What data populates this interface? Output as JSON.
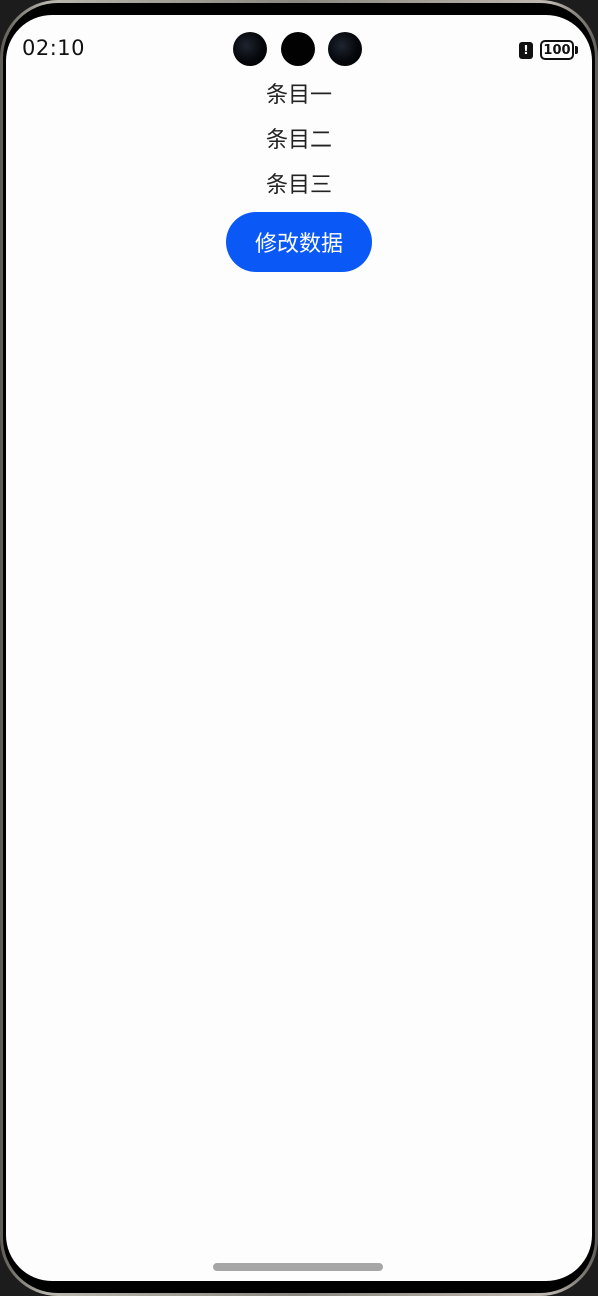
{
  "status_bar": {
    "time": "02:10",
    "battery_level": "100",
    "alert_glyph": "!",
    "icons": [
      "camera-dot",
      "camera-dot",
      "camera-dot",
      "alert-icon",
      "battery-icon"
    ]
  },
  "list": {
    "items": [
      {
        "label": "条目一"
      },
      {
        "label": "条目二"
      },
      {
        "label": "条目三"
      }
    ]
  },
  "button": {
    "label": "修改数据",
    "color": "#0a59f7"
  },
  "colors": {
    "screen_background": "#fdfdfd",
    "text": "#222222",
    "button_text": "#ffffff"
  }
}
